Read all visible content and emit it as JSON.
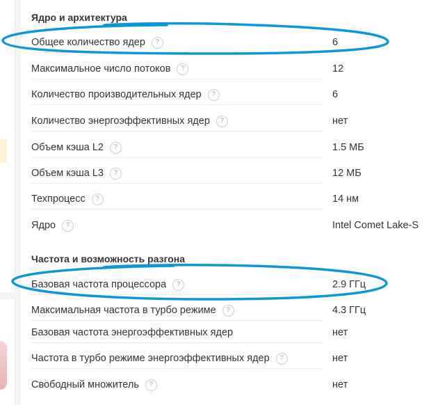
{
  "colors": {
    "annotation": "#0b98d6",
    "help_icon": "#c8c8c8",
    "text": "#333333"
  },
  "sections": [
    {
      "title": "Ядро и архитектура",
      "rows": [
        {
          "label": "Общее количество ядер",
          "value": "6"
        },
        {
          "label": "Максимальное число потоков",
          "value": "12"
        },
        {
          "label": "Количество производительных ядер",
          "value": "6"
        },
        {
          "label": "Количество энергоэффективных ядер",
          "value": "нет"
        },
        {
          "label": "Объем кэша L2",
          "value": "1.5 МБ"
        },
        {
          "label": "Объем кэша L3",
          "value": "12 МБ"
        },
        {
          "label": "Техпроцесс",
          "value": "14 нм"
        },
        {
          "label": "Ядро",
          "value": "Intel Comet Lake-S"
        }
      ]
    },
    {
      "title": "Частота и возможность разгона",
      "rows": [
        {
          "label": "Базовая частота процессора",
          "value": "2.9 ГГц"
        },
        {
          "label": "Максимальная частота в турбо режиме",
          "value": "4.3 ГГц"
        },
        {
          "label": "Базовая частота энергоэффективных ядер",
          "value": "нет"
        },
        {
          "label": "Частота в турбо режиме энергоэффективных ядер",
          "value": "нет"
        },
        {
          "label": "Свободный множитель",
          "value": "нет"
        }
      ]
    }
  ],
  "help_icon_glyph": "?"
}
